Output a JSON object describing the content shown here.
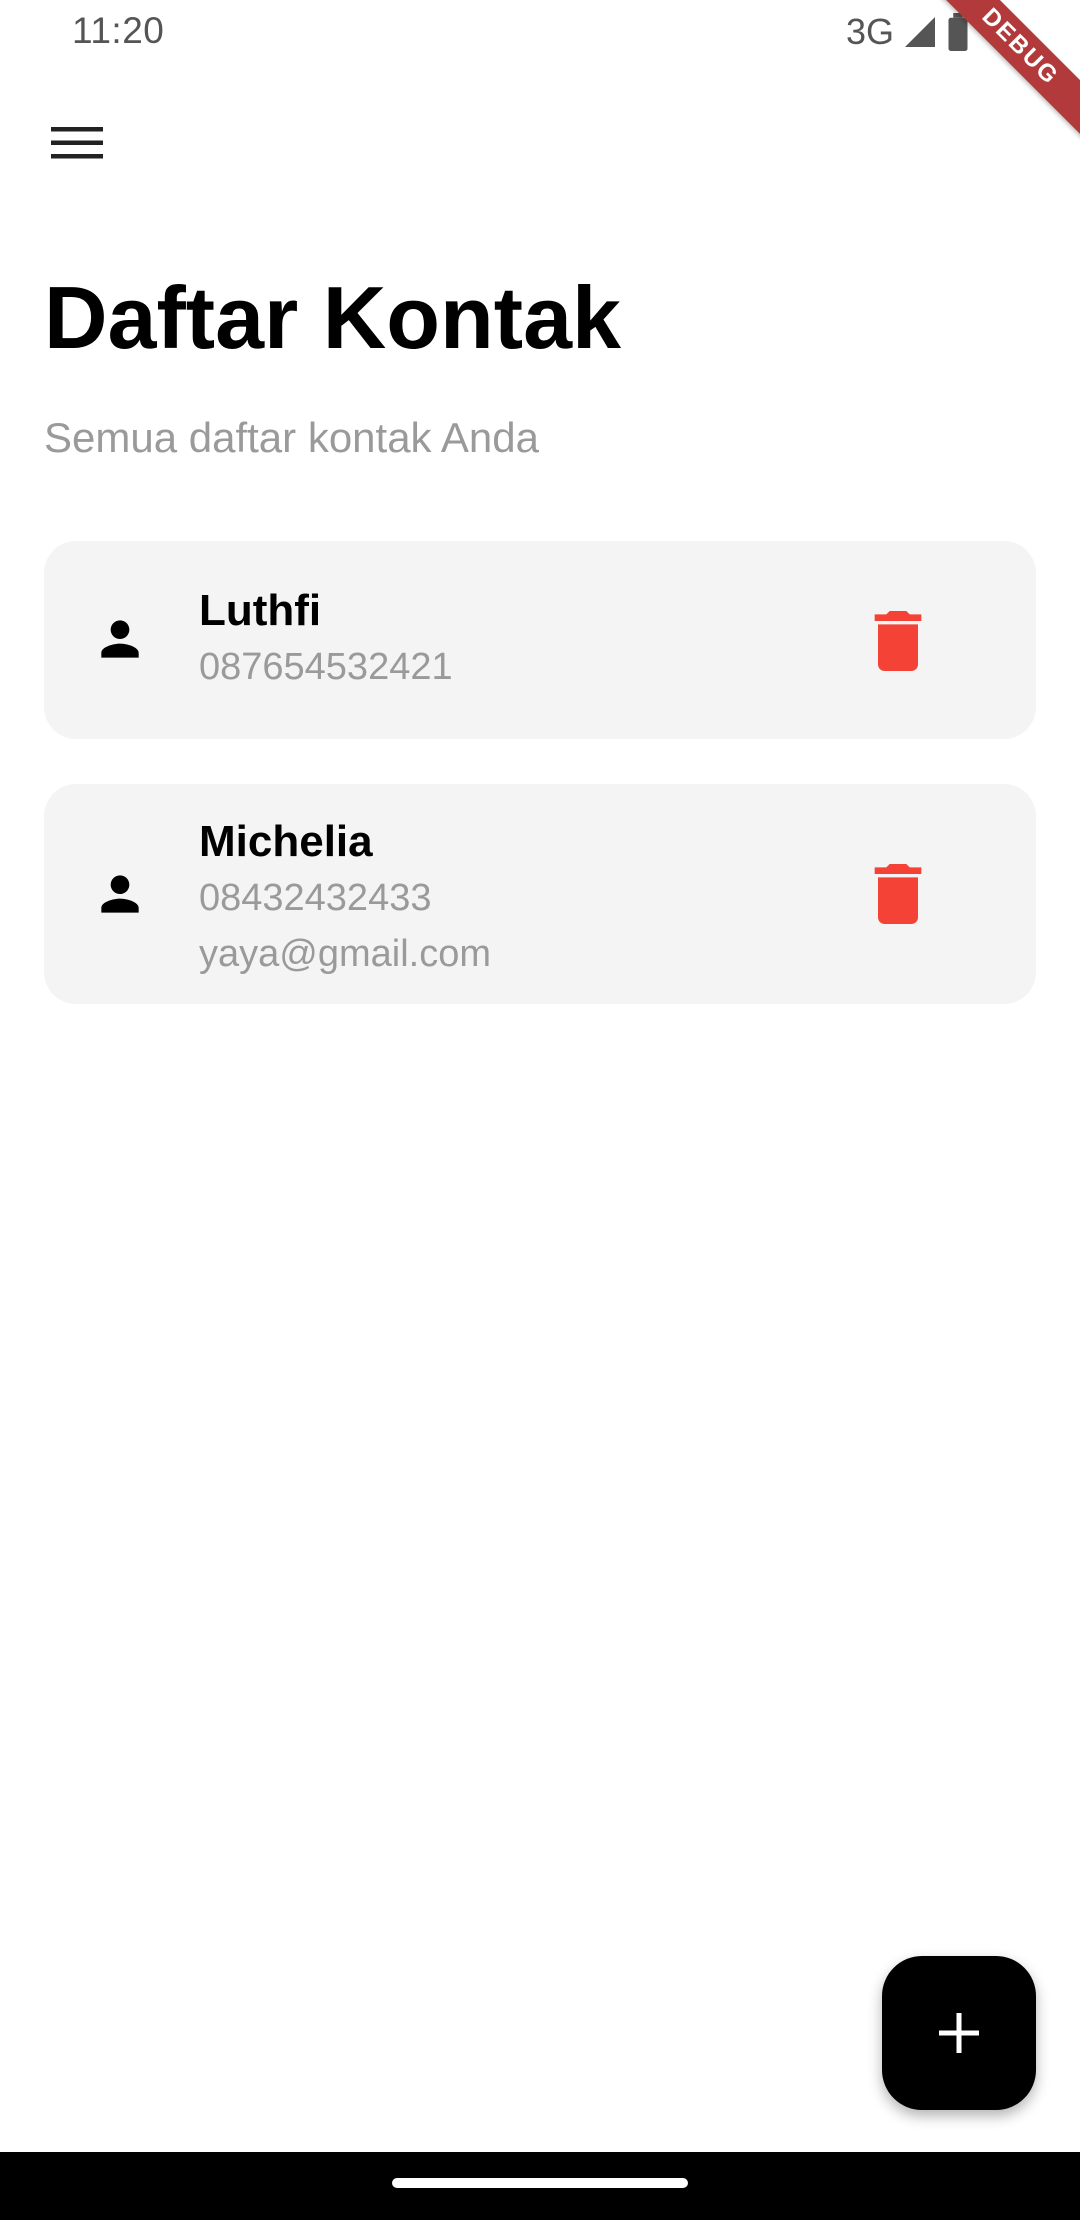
{
  "status_bar": {
    "time": "11:20",
    "network": "3G",
    "icons": [
      "signal-icon",
      "battery-icon"
    ]
  },
  "debug_banner": "DEBUG",
  "app_bar": {
    "menu_icon": "menu-icon"
  },
  "header": {
    "title": "Daftar Kontak",
    "subtitle": "Semua daftar kontak Anda"
  },
  "contacts": [
    {
      "name": "Luthfi",
      "phone": "087654532421",
      "icon": "person-icon",
      "action_icon": "delete-icon"
    },
    {
      "name": "Michelia",
      "phone": "08432432433",
      "email": "yaya@gmail.com",
      "icon": "person-icon",
      "action_icon": "delete-icon"
    }
  ],
  "fab": {
    "icon": "add-icon"
  },
  "colors": {
    "card_background": "#f4f4f4",
    "delete_red": "#f44336",
    "subtitle_gray": "#9a9a9a",
    "fab_background": "#000000"
  }
}
